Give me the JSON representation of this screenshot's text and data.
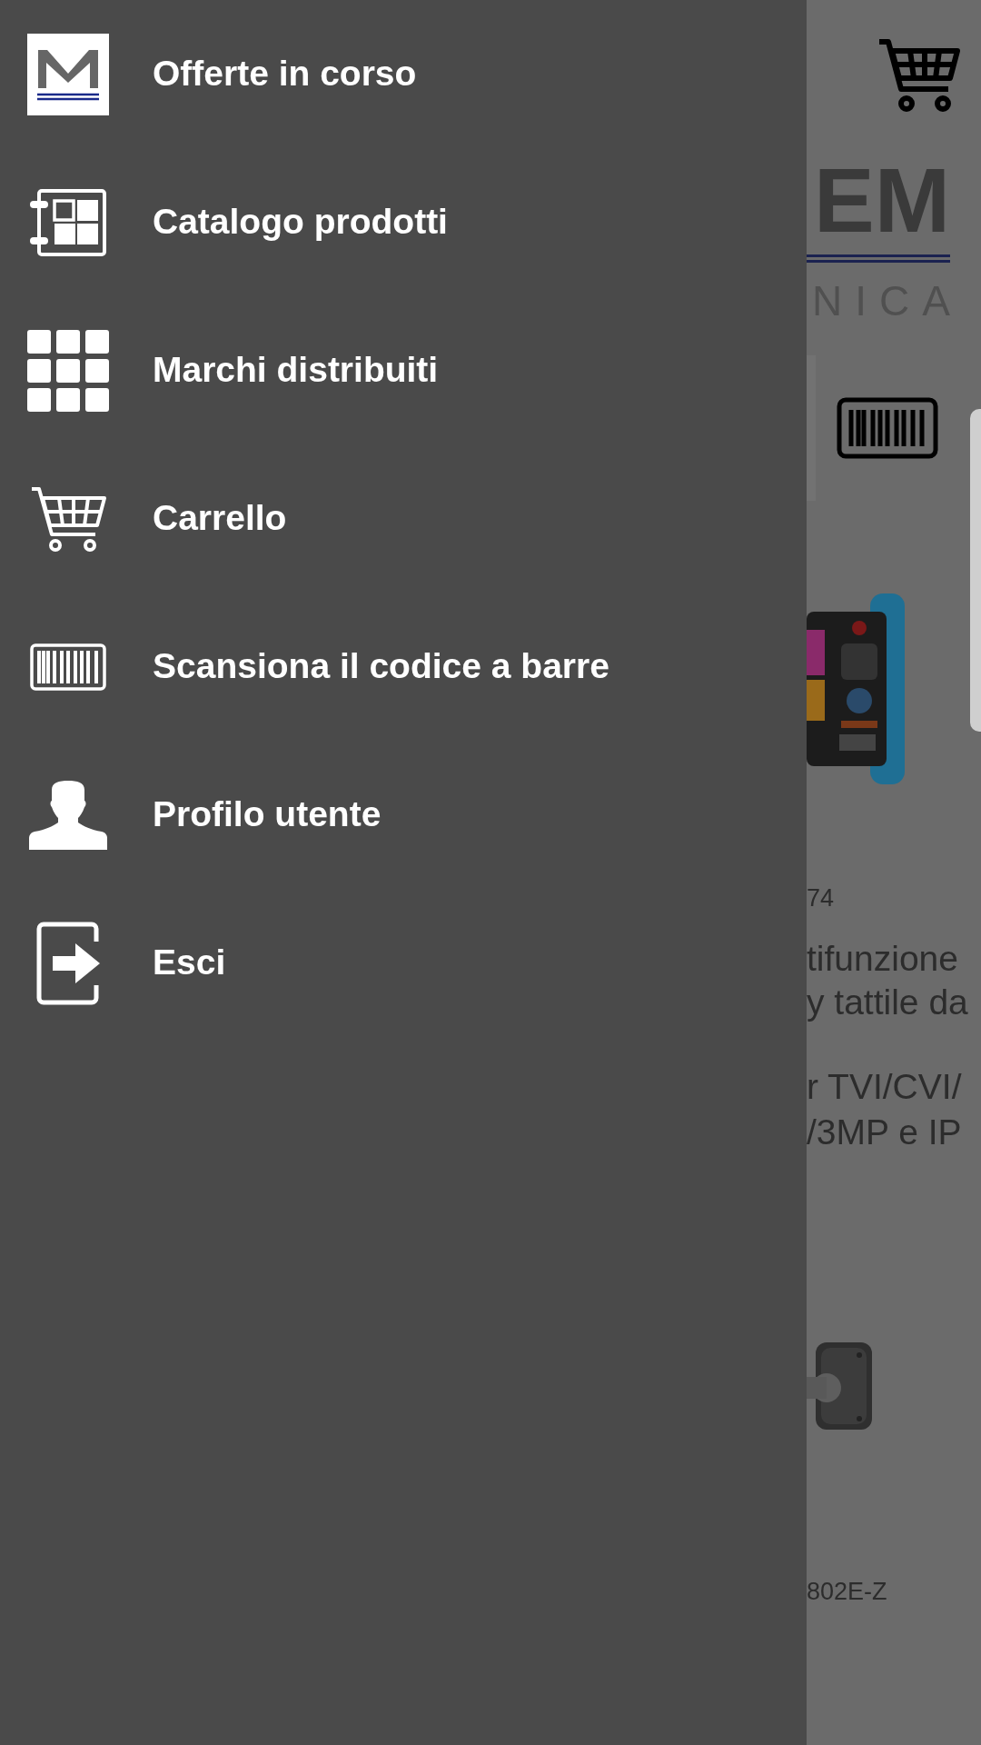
{
  "drawer": {
    "items": [
      {
        "kind": "logo",
        "label": "Offerte in corso"
      },
      {
        "kind": "catalog",
        "label": "Catalogo prodotti"
      },
      {
        "kind": "grid",
        "label": "Marchi distribuiti"
      },
      {
        "kind": "cart",
        "label": "Carrello"
      },
      {
        "kind": "barcode",
        "label": "Scansiona il codice a barre"
      },
      {
        "kind": "user",
        "label": "Profilo utente"
      },
      {
        "kind": "exit",
        "label": "Esci"
      }
    ]
  },
  "background": {
    "logo_text": "EM",
    "logo_subtitle": "NICA",
    "products": [
      {
        "code": "74",
        "title_lines": [
          "tifunzione",
          "y tattile da"
        ],
        "subtitle_lines": [
          "r TVI/CVI/",
          "/3MP e IP"
        ]
      },
      {
        "code": "802E-Z"
      }
    ]
  }
}
